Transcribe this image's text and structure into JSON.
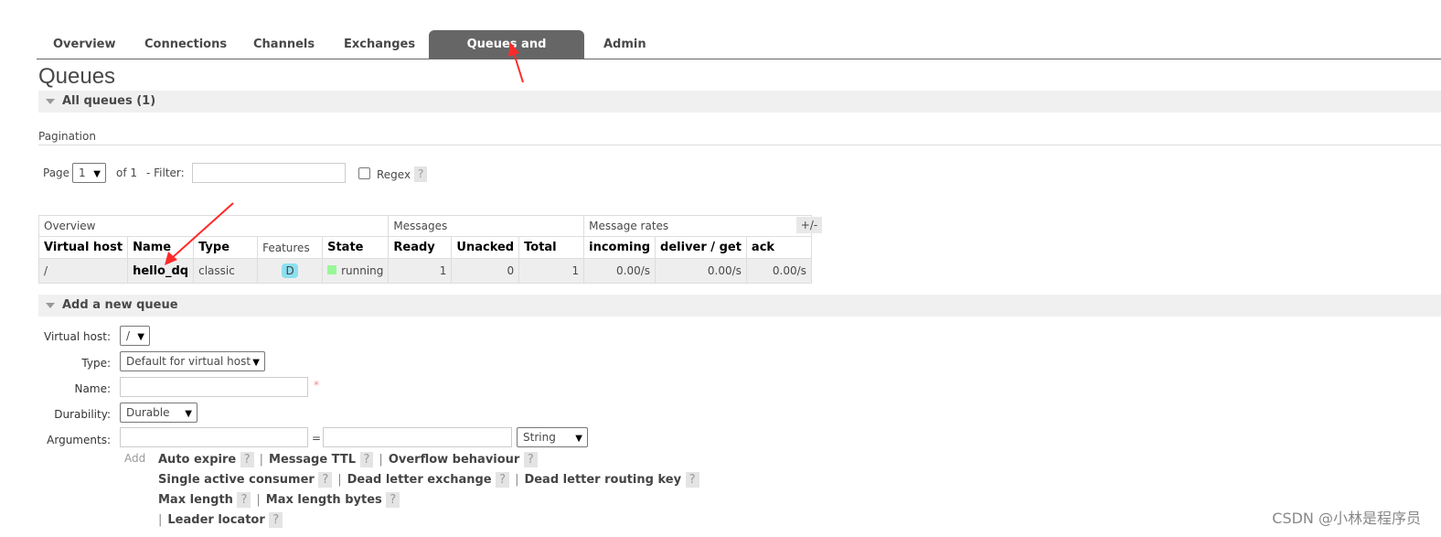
{
  "tabs": [
    {
      "label": "Overview"
    },
    {
      "label": "Connections"
    },
    {
      "label": "Channels"
    },
    {
      "label": "Exchanges"
    },
    {
      "label": "Queues and Streams",
      "active": true
    },
    {
      "label": "Admin"
    }
  ],
  "page_title": "Queues",
  "all_queues": {
    "header": "All queues (1)",
    "pagination_label": "Pagination",
    "page_label": "Page",
    "page_value": "1",
    "of_label": "of 1",
    "filter_label": "- Filter:",
    "filter_value": "",
    "regex_label": "Regex",
    "help": "?"
  },
  "table": {
    "groups": [
      "Overview",
      "Messages",
      "Message rates"
    ],
    "columns": [
      "Virtual host",
      "Name",
      "Type",
      "Features",
      "State",
      "Ready",
      "Unacked",
      "Total",
      "incoming",
      "deliver / get",
      "ack"
    ],
    "toggle": "+/-",
    "rows": [
      {
        "vhost": "/",
        "name": "hello_dq",
        "type": "classic",
        "features": "D",
        "state": "running",
        "ready": "1",
        "unacked": "0",
        "total": "1",
        "incoming": "0.00/s",
        "deliver": "0.00/s",
        "ack": "0.00/s"
      }
    ]
  },
  "add_queue": {
    "header": "Add a new queue",
    "vhost_label": "Virtual host:",
    "vhost_value": "/",
    "type_label": "Type:",
    "type_value": "Default for virtual host",
    "name_label": "Name:",
    "name_value": "",
    "required": "*",
    "durability_label": "Durability:",
    "durability_value": "Durable",
    "arguments_label": "Arguments:",
    "eq": "=",
    "arg_type": "String",
    "add_label": "Add",
    "arg_links": [
      "Auto expire",
      "Message TTL",
      "Overflow behaviour",
      "Single active consumer",
      "Dead letter exchange",
      "Dead letter routing key",
      "Max length",
      "Max length bytes",
      "Leader locator"
    ],
    "help": "?",
    "sep": "|"
  },
  "colors": {
    "active_tab": "#666666",
    "state_running": "#98f898",
    "badge": "#8ce0f0",
    "annotation": "#ff2a2a"
  },
  "watermark": "CSDN @小林是程序员"
}
